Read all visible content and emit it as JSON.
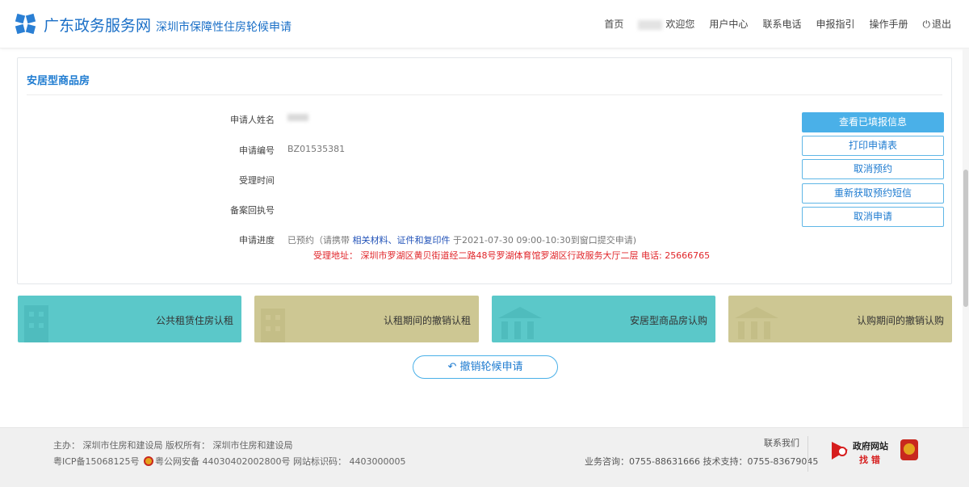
{
  "header": {
    "site_name": "广东政务服务网",
    "subtitle": "深圳市保障性住房轮候申请",
    "nav": {
      "home": "首页",
      "welcome": "欢迎您",
      "user_center": "用户中心",
      "contact": "联系电话",
      "guide": "申报指引",
      "manual": "操作手册",
      "logout": "退出"
    }
  },
  "card": {
    "title": "安居型商品房",
    "fields": {
      "applicant_label": "申请人姓名",
      "number_label": "申请编号",
      "number_value": "BZ01535381",
      "accept_time_label": "受理时间",
      "record_label": "备案回执号",
      "progress_label": "申请进度"
    },
    "progress": {
      "prefix": "已预约（请携带",
      "link": "相关材料、证件和复印件",
      "suffix": "于2021-07-30 09:00-10:30到窗口提交申请)",
      "address": "受理地址： 深圳市罗湖区黄贝街道经二路48号罗湖体育馆罗湖区行政服务大厅二层 电话: 25666765"
    },
    "actions": {
      "view": "查看已填报信息",
      "print": "打印申请表",
      "cancel_booking": "取消预约",
      "resend_sms": "重新获取预约短信",
      "cancel_application": "取消申请"
    }
  },
  "tiles": {
    "t1": "公共租赁住房认租",
    "t2": "认租期间的撤销认租",
    "t3": "安居型商品房认购",
    "t4": "认购期间的撤销认购"
  },
  "revoke_label": "撤销轮候申请",
  "footer": {
    "sponsor": "主办：  深圳市住房和建设局  版权所有：  深圳市住房和建设局",
    "icp": "粤ICP备15068125号",
    "police": "粤公网安备 44030402002800号",
    "site_code": "网站标识码：  4403000005",
    "contact_title": "联系我们",
    "contact_line": "业务咨询：0755-88631666  技术支持：0755-83679045",
    "gov_title": "政府网站",
    "gov_sub": "找 错"
  },
  "colors": {
    "brand": "#1a6fc7",
    "accent": "#4ab0e8",
    "tile_teal": "#5bc8c9",
    "tile_olive": "#cdc793",
    "alert": "#e0262a"
  }
}
